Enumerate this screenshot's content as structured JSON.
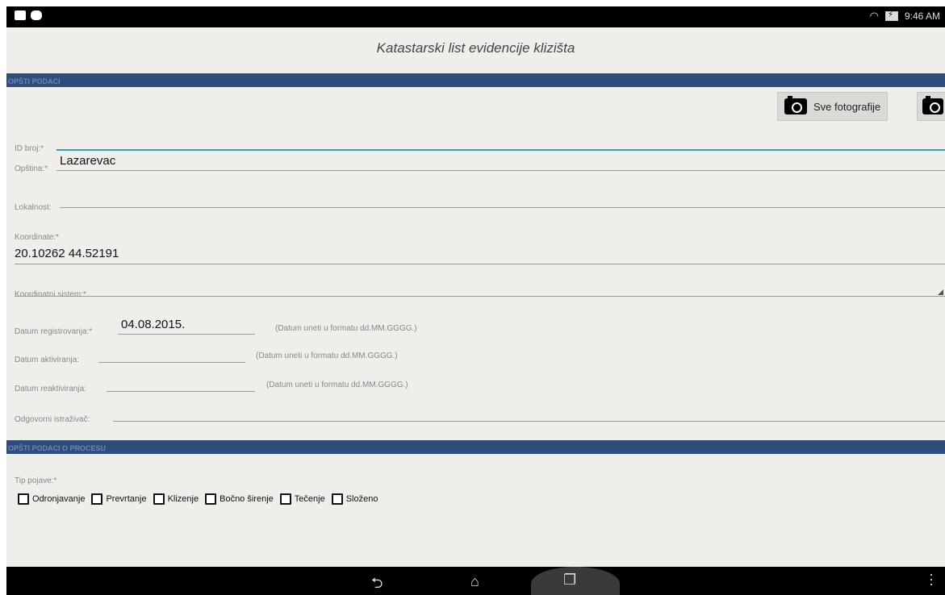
{
  "status_bar": {
    "time": "9:46 AM"
  },
  "app_title": "Katastarski list evidencije klizišta",
  "sections": {
    "general": "OPŠTI PODACI",
    "process": "OPŠTI PODACI O PROCESU"
  },
  "buttons": {
    "all_photos": "Sve fotografije"
  },
  "fields": {
    "id_label": "ID broj:*",
    "id_value": "",
    "municipality_label": "Opština:*",
    "municipality_value": "Lazarevac",
    "locality_label": "Lokalnost:",
    "locality_value": "",
    "coords_label": "Koordinate:*",
    "coords_value": "20.10262 44.52191",
    "coord_system_label": "Koordinatni sistem:*",
    "reg_date_label": "Datum registrovanja:*",
    "reg_date_value": "04.08.2015.",
    "act_date_label": "Datum aktiviranja:",
    "react_date_label": "Datum reaktiviranja:",
    "date_hint": "(Datum uneti u formatu dd.MM.GGGG.)",
    "researcher_label": "Odgovorni istraživač:"
  },
  "phenomenon": {
    "label": "Tip pojave:*",
    "options": [
      "Odronjavanje",
      "Prevrtanje",
      "Klizenje",
      "Bočno širenje",
      "Tečenje",
      "Složeno"
    ]
  },
  "colors": {
    "accent": "#2f4d7a",
    "focus": "#33a0b5",
    "background": "#f0eeeb"
  }
}
